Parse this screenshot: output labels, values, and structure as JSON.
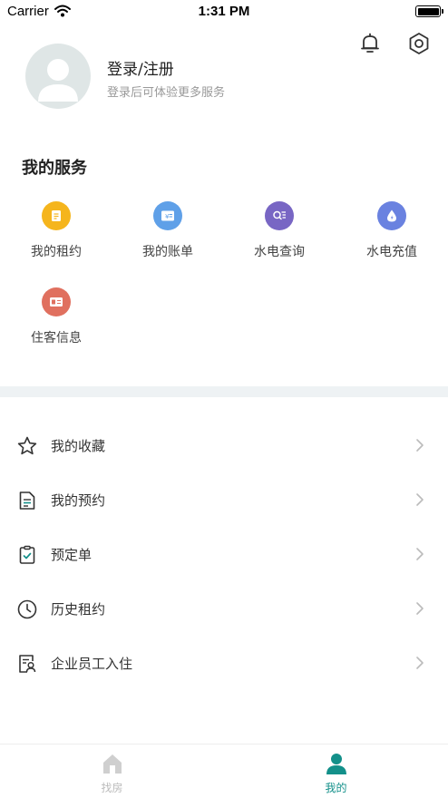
{
  "status_bar": {
    "carrier": "Carrier",
    "time": "1:31 PM"
  },
  "profile": {
    "login_title": "登录/注册",
    "login_subtitle": "登录后可体验更多服务"
  },
  "services": {
    "title": "我的服务",
    "items": [
      {
        "label": "我的租约",
        "icon": "document-icon",
        "color": "#f5b51d"
      },
      {
        "label": "我的账单",
        "icon": "bill-icon",
        "color": "#5fa0e8"
      },
      {
        "label": "水电查询",
        "icon": "search-list-icon",
        "color": "#7866c4"
      },
      {
        "label": "水电充值",
        "icon": "water-drop-icon",
        "color": "#6a82e0"
      },
      {
        "label": "住客信息",
        "icon": "id-card-icon",
        "color": "#e0705f"
      }
    ]
  },
  "menu": [
    {
      "label": "我的收藏",
      "icon": "star-icon"
    },
    {
      "label": "我的预约",
      "icon": "document-list-icon"
    },
    {
      "label": "预定单",
      "icon": "clipboard-check-icon"
    },
    {
      "label": "历史租约",
      "icon": "clock-icon"
    },
    {
      "label": "企业员工入住",
      "icon": "employee-card-icon"
    }
  ],
  "tabbar": {
    "tabs": [
      {
        "label": "找房",
        "icon": "house-icon",
        "active": false
      },
      {
        "label": "我的",
        "icon": "person-icon",
        "active": true
      }
    ],
    "active_color": "#13908a",
    "inactive_color": "#bbbbbb"
  }
}
